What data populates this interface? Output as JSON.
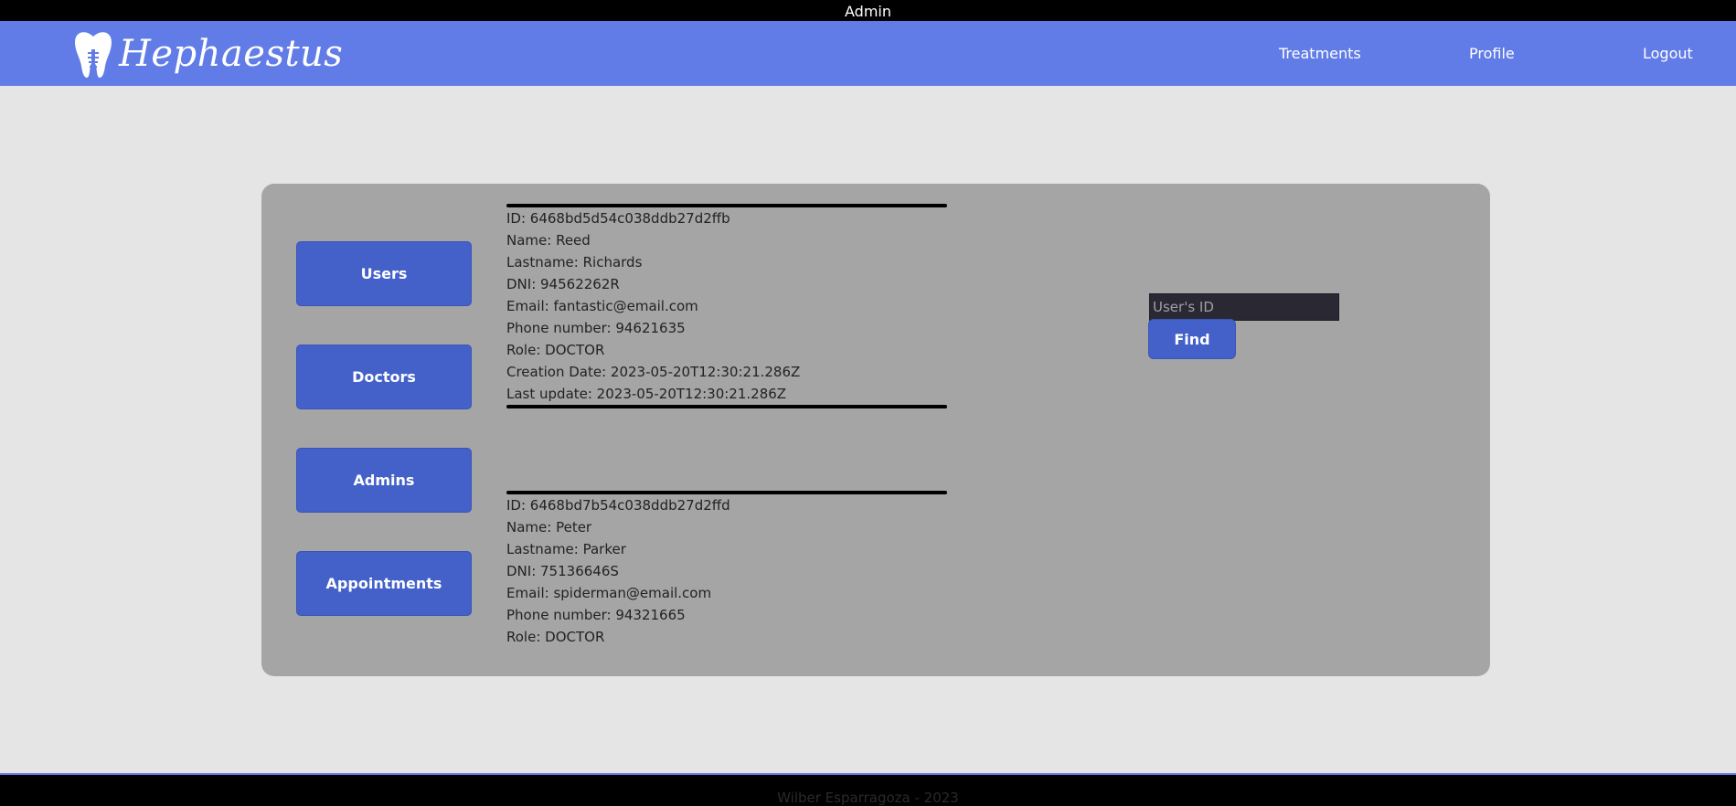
{
  "topbar": {
    "role_label": "Admin"
  },
  "brand": {
    "logo_icon": "tooth-icon",
    "name": "Hephaestus"
  },
  "nav": {
    "treatments": "Treatments",
    "profile": "Profile",
    "logout": "Logout"
  },
  "sidebar": {
    "users": "Users",
    "doctors": "Doctors",
    "admins": "Admins",
    "appointments": "Appointments"
  },
  "users": [
    {
      "id": "ID: 6468bd5d54c038ddb27d2ffb",
      "name": "Name: Reed",
      "lastname": "Lastname: Richards",
      "dni": "DNI: 94562262R",
      "email": "Email: fantastic@email.com",
      "phone": "Phone number: 94621635",
      "role": "Role: DOCTOR",
      "created": "Creation Date: 2023-05-20T12:30:21.286Z",
      "updated": "Last update: 2023-05-20T12:30:21.286Z"
    },
    {
      "id": "ID: 6468bd7b54c038ddb27d2ffd",
      "name": "Name: Peter",
      "lastname": "Lastname: Parker",
      "dni": "DNI: 75136646S",
      "email": "Email: spiderman@email.com",
      "phone": "Phone number: 94321665",
      "role": "Role: DOCTOR"
    }
  ],
  "search": {
    "placeholder": "User's ID",
    "value": "",
    "button": "Find"
  },
  "footer": {
    "text": "Wilber Esparragoza - 2023"
  },
  "colors": {
    "navbar": "#617ce6",
    "button": "#4361c9",
    "panel": "#a5a5a5",
    "background": "#e5e5e5"
  }
}
